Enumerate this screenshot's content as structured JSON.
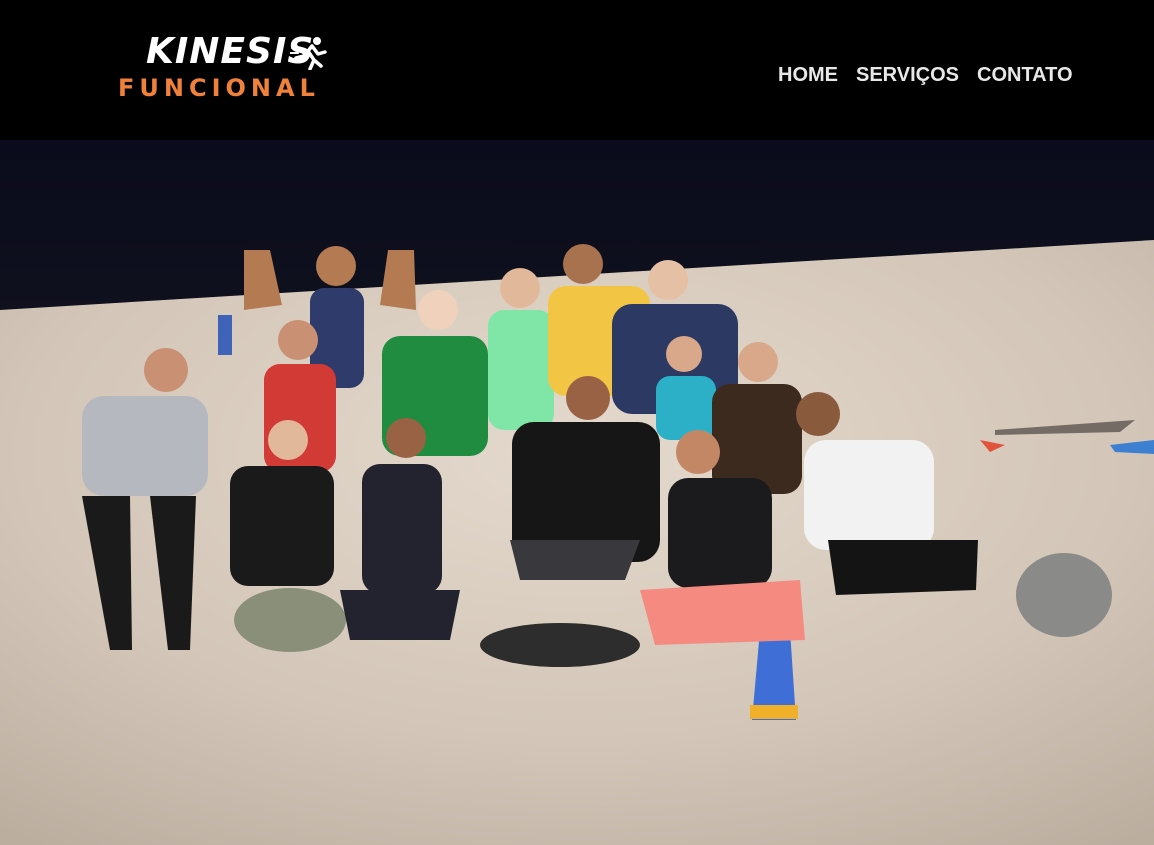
{
  "header": {
    "logo": {
      "line1": "KINESIS",
      "line2": "FUNCIONAL",
      "icon": "runner-icon",
      "accent_color": "#f0813a"
    },
    "nav": [
      {
        "label": "HOME"
      },
      {
        "label": "SERVIÇOS"
      },
      {
        "label": "CONTATO"
      }
    ]
  },
  "hero": {
    "image": "group-photo-beach-night"
  },
  "colors": {
    "header_bg": "#000000",
    "nav_text": "#e8e8e8",
    "sand": "#d8ccbf",
    "night_sky": "#0c0d1a"
  }
}
